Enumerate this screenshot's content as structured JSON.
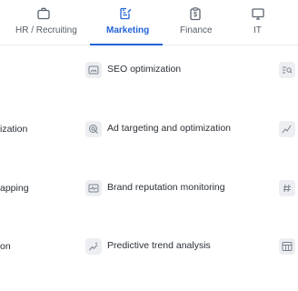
{
  "tabs": [
    {
      "label": "HR / Recruiting",
      "icon": "briefcase-icon",
      "active": false
    },
    {
      "label": "Marketing",
      "icon": "edit-document-icon",
      "active": true
    },
    {
      "label": "Finance",
      "icon": "dollar-clipboard-icon",
      "active": false
    },
    {
      "label": "IT",
      "icon": "monitor-icon",
      "active": false
    }
  ],
  "left_items": [
    "ization",
    "apping",
    "on"
  ],
  "center_items": [
    {
      "label": "SEO optimization",
      "icon": "image-frame-icon"
    },
    {
      "label": "Ad targeting and optimization",
      "icon": "target-cursor-icon"
    },
    {
      "label": "Brand reputation monitoring",
      "icon": "pulse-chart-icon"
    },
    {
      "label": "Predictive trend analysis",
      "icon": "sparkle-trend-icon"
    }
  ],
  "right_icons": [
    "search-text-icon",
    "trend-line-icon",
    "hashtag-icon",
    "table-icon"
  ],
  "colors": {
    "accent": "#2363d8",
    "chip": "#eceef1",
    "divider": "#e9ebee"
  }
}
